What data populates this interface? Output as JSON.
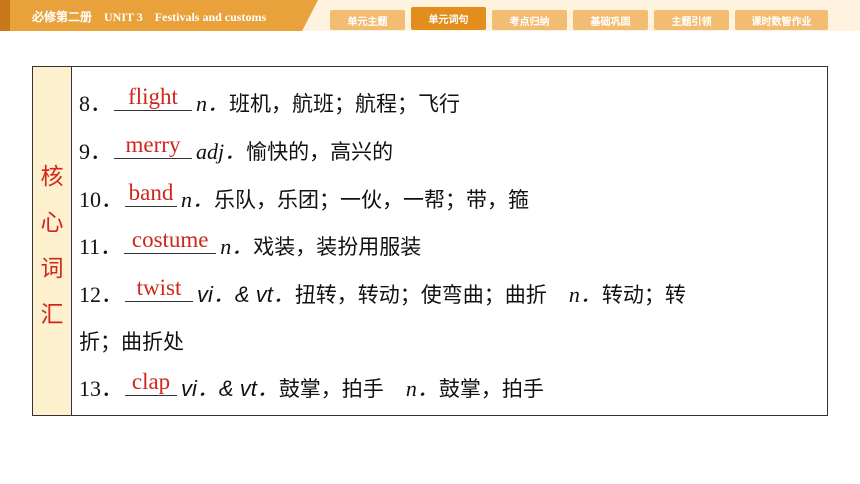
{
  "header": {
    "title": "必修第二册　UNIT 3　Festivals and customs",
    "tabs": [
      {
        "label": "单元主题",
        "active": false
      },
      {
        "label": "单元词句",
        "active": true
      },
      {
        "label": "考点归纳",
        "active": false
      },
      {
        "label": "基础巩固",
        "active": false
      },
      {
        "label": "主题引领",
        "active": false
      },
      {
        "label": "课时数智作业",
        "active": false
      }
    ]
  },
  "sidebar": {
    "chars": [
      "核",
      "心",
      "词",
      "汇"
    ]
  },
  "entries": [
    {
      "num": "8．",
      "answer": "flight",
      "pos": "n．",
      "meaning": "班机，航班；航程；飞行"
    },
    {
      "num": "9．",
      "answer": "merry",
      "pos": "adj．",
      "meaning": "愉快的，高兴的"
    },
    {
      "num": "10．",
      "answer": "band",
      "pos": "n．",
      "meaning": "乐队，乐团；一伙，一帮；带，箍"
    },
    {
      "num": "11．",
      "answer": "costume",
      "pos": "n．",
      "meaning": "戏装，装扮用服装"
    },
    {
      "num": "12．",
      "answer": "twist",
      "pos": "vi．& vt．",
      "meaning": "扭转，转动；使弯曲；曲折",
      "pos2": "n．",
      "meaning2": "转动；转",
      "continuation": "折；曲折处"
    },
    {
      "num": "13．",
      "answer": "clap",
      "pos": "vi．& vt．",
      "meaning": "鼓掌，拍手",
      "pos2": "n．",
      "meaning2": "鼓掌，拍手"
    }
  ],
  "colors": {
    "accent": "#e9a13b",
    "tab_active": "#e28d1c",
    "tab": "#f2bd72",
    "answer": "#d0261c",
    "sidebar_bg": "#fdf0cf"
  }
}
